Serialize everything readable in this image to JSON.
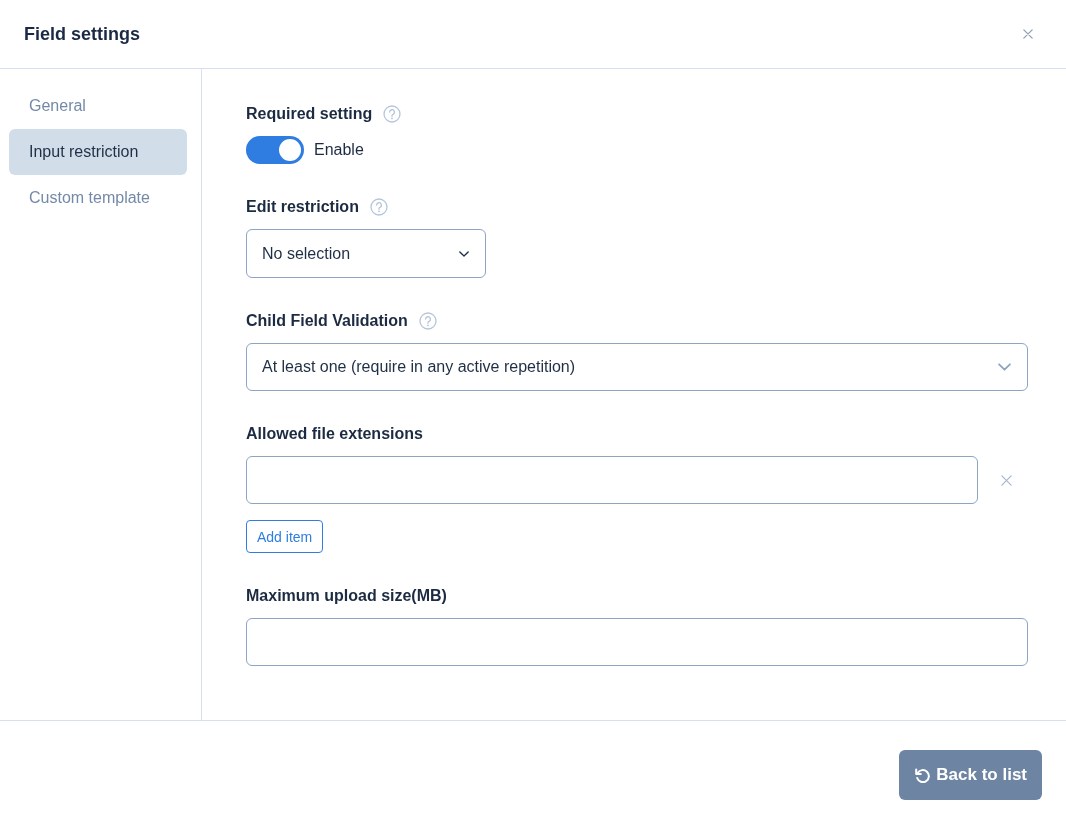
{
  "dialog": {
    "title": "Field settings"
  },
  "sidebar": {
    "items": [
      {
        "label": "General",
        "selected": false
      },
      {
        "label": "Input restriction",
        "selected": true
      },
      {
        "label": "Custom template",
        "selected": false
      }
    ]
  },
  "fields": [
    {
      "kind": "toggle",
      "label": "Required setting",
      "help": true,
      "on": true,
      "text": "Enable"
    },
    {
      "kind": "select",
      "label": "Edit restriction",
      "help": true,
      "value": "No selection"
    },
    {
      "kind": "select",
      "label": "Child Field Validation",
      "help": true,
      "value": "At least one (require in any active repetition)"
    },
    {
      "kind": "list",
      "label": "Allowed file extensions",
      "help": false,
      "entries": [
        {
          "removable": true
        }
      ],
      "add_label": "Add item"
    },
    {
      "kind": "input",
      "label": "Maximum upload size(MB)",
      "help": false
    }
  ],
  "footer": {
    "button": "Back to list"
  }
}
